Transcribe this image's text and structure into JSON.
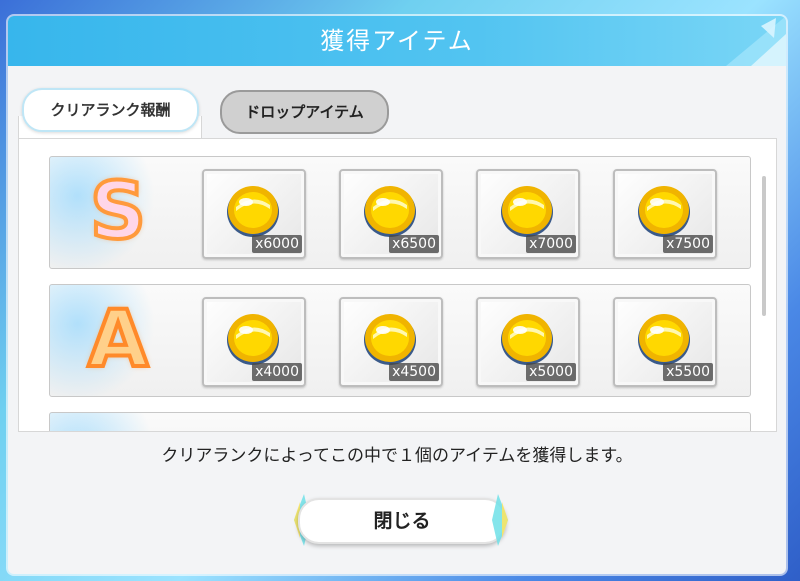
{
  "dialog": {
    "title": "獲得アイテム",
    "tabs": [
      {
        "label": "クリアランク報酬",
        "active": true
      },
      {
        "label": "ドロップアイテム",
        "active": false
      }
    ],
    "rows": [
      {
        "rank": "S",
        "items": [
          {
            "icon": "gold-coin-icon",
            "qty": "x6000"
          },
          {
            "icon": "gold-coin-icon",
            "qty": "x6500"
          },
          {
            "icon": "gold-coin-icon",
            "qty": "x7000"
          },
          {
            "icon": "gold-coin-icon",
            "qty": "x7500"
          }
        ]
      },
      {
        "rank": "A",
        "items": [
          {
            "icon": "gold-coin-icon",
            "qty": "x4000"
          },
          {
            "icon": "gold-coin-icon",
            "qty": "x4500"
          },
          {
            "icon": "gold-coin-icon",
            "qty": "x5000"
          },
          {
            "icon": "gold-coin-icon",
            "qty": "x5500"
          }
        ]
      }
    ],
    "message": "クリアランクによってこの中で１個のアイテムを獲得します。",
    "close_label": "閉じる"
  },
  "colors": {
    "header": "#37b6ec",
    "coin": "#f7c300",
    "tab_active_border": "#bfe6f6",
    "tab_inactive": "#d0d0d0"
  }
}
